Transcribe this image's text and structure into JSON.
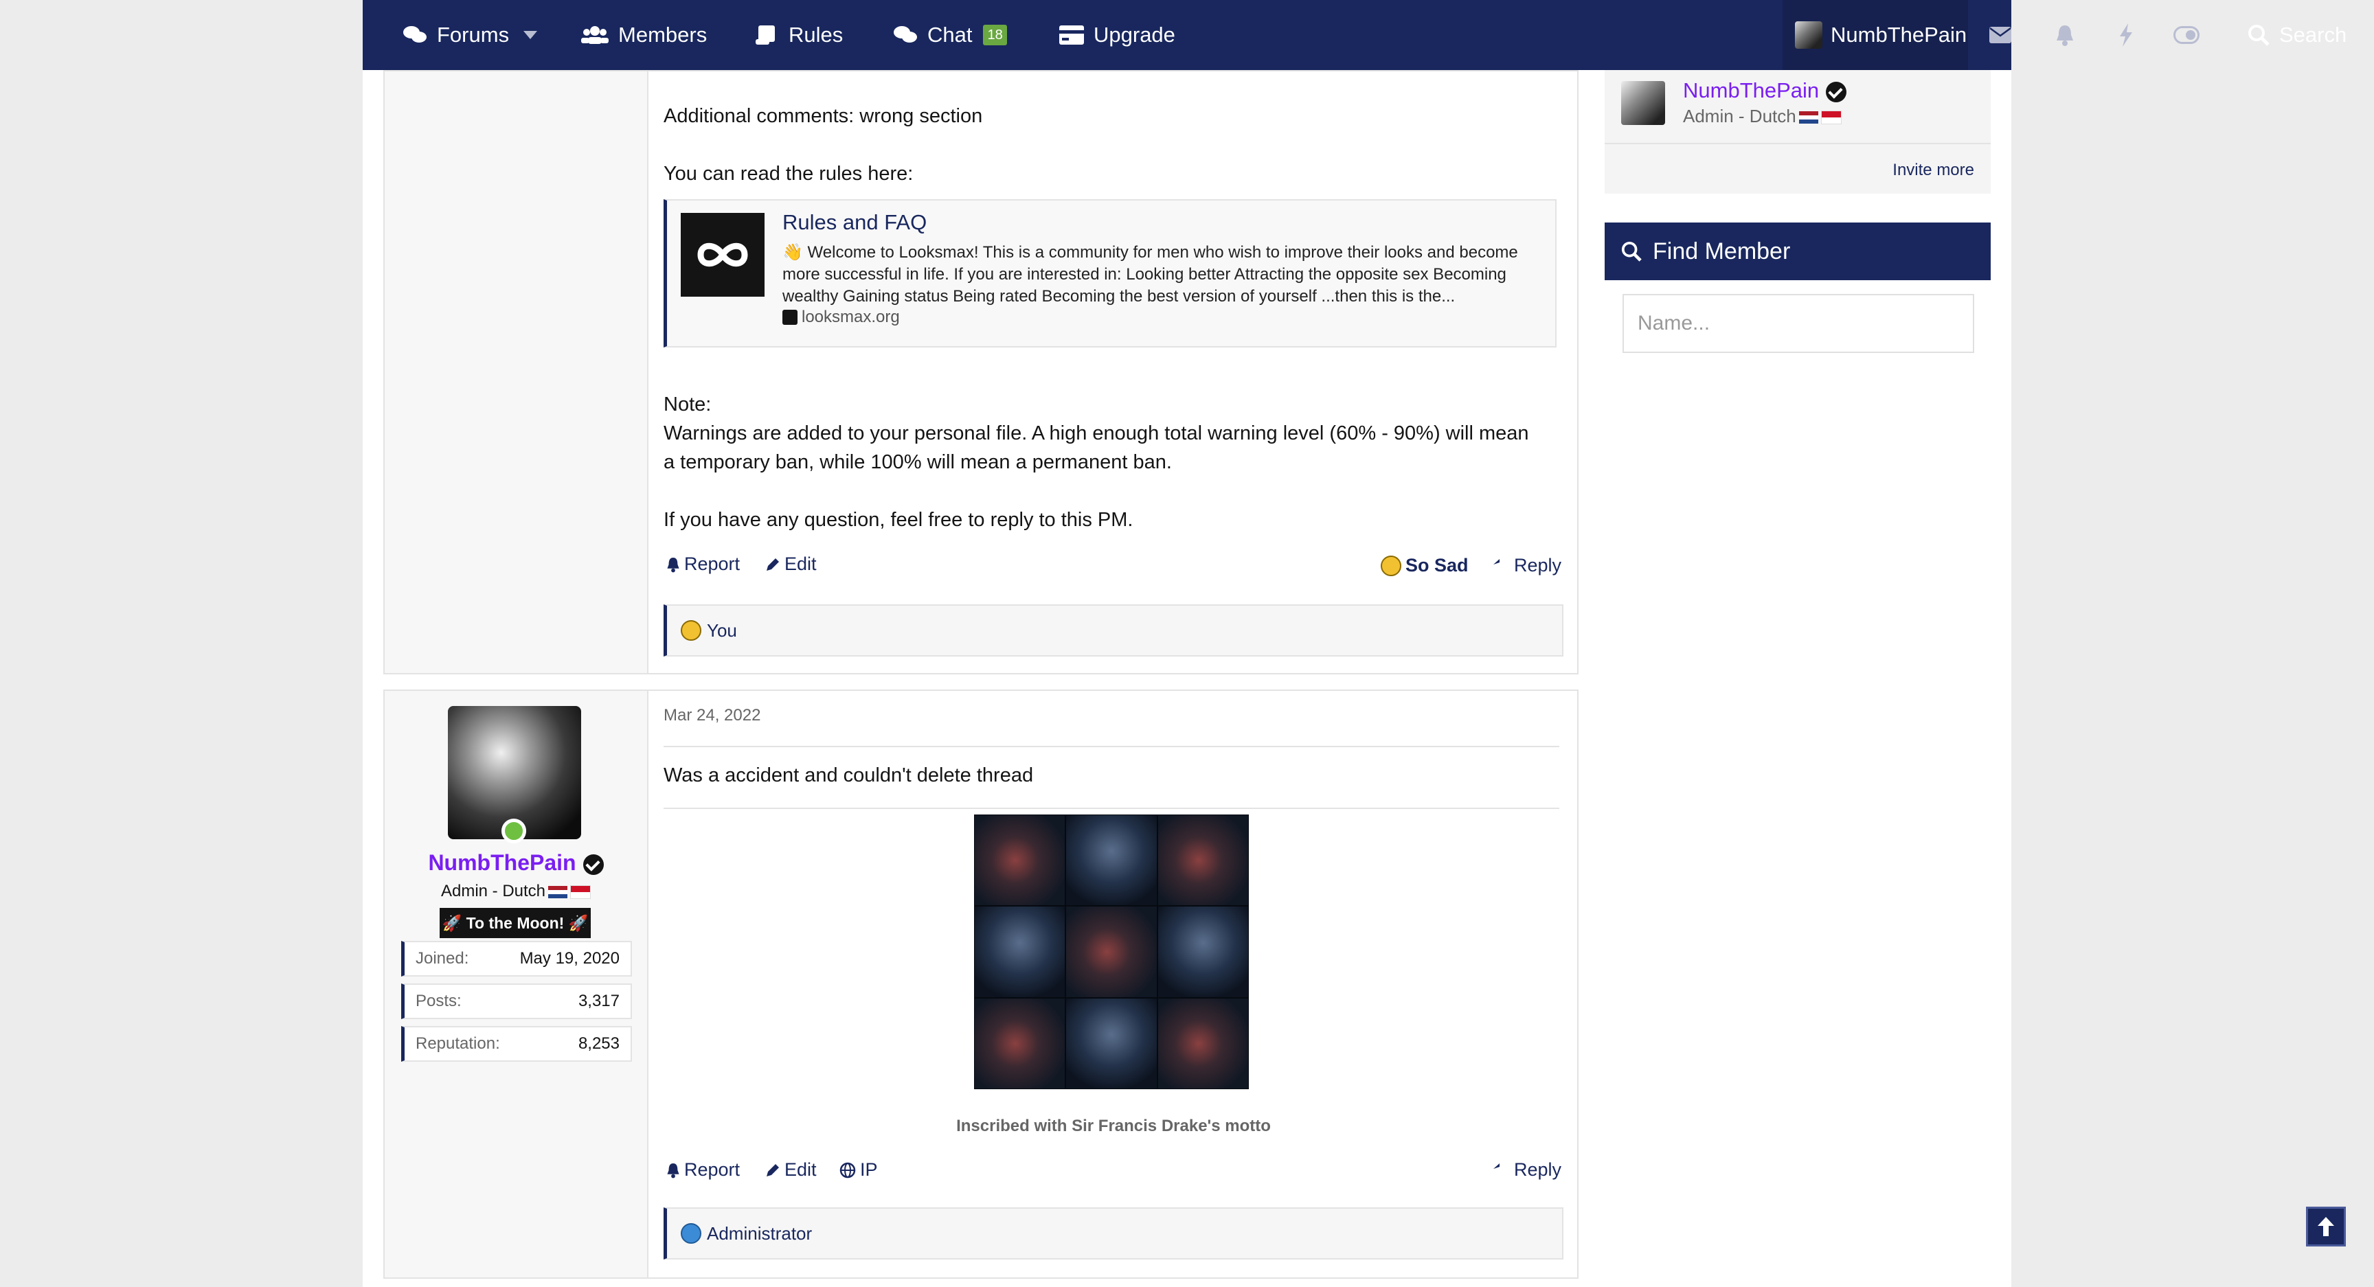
{
  "nav": {
    "forums": "Forums",
    "members": "Members",
    "rules": "Rules",
    "chat": "Chat",
    "chat_count": "18",
    "upgrade": "Upgrade",
    "username": "NumbThePain",
    "search": "Search"
  },
  "post1": {
    "additional_comments": "Additional comments: wrong section",
    "rules_intro": "You can read the rules here:",
    "unfurl": {
      "title": "Rules and FAQ",
      "description": "👋 Welcome to Looksmax! This is a community for men who wish to improve their looks and become more successful in life. If you are interested in: Looking better Attracting the opposite sex Becoming wealthy Gaining status Being rated Becoming the best version of yourself ...then this is the...",
      "domain": "looksmax.org"
    },
    "note_label": "Note:",
    "note_text": "Warnings are added to your personal file. A high enough total warning level (60% - 90%) will mean a temporary ban, while 100% will mean a permanent ban.",
    "closing": "If you have any question, feel free to reply to this PM.",
    "actions": {
      "report": "Report",
      "edit": "Edit",
      "reaction": "So Sad",
      "reply": "Reply"
    },
    "reacted_by": "You"
  },
  "post2": {
    "user": {
      "name": "NumbThePain",
      "title": "Admin - Dutch",
      "banner": "🚀 To the Moon! 🚀",
      "stats": [
        {
          "label": "Joined:",
          "value": "May 19, 2020"
        },
        {
          "label": "Posts:",
          "value": "3,317"
        },
        {
          "label": "Reputation:",
          "value": "8,253"
        }
      ]
    },
    "date": "Mar 24, 2022",
    "text": "Was a accident and couldn't delete thread",
    "caption": "Inscribed with Sir Francis Drake's motto",
    "actions": {
      "report": "Report",
      "edit": "Edit",
      "ip": "IP",
      "reply": "Reply"
    },
    "reacted_by": "Administrator"
  },
  "sidebar": {
    "user": {
      "name": "NumbThePain",
      "title": "Admin - Dutch"
    },
    "invite_more": "Invite more",
    "find_member_title": "Find Member",
    "find_member_placeholder": "Name..."
  }
}
